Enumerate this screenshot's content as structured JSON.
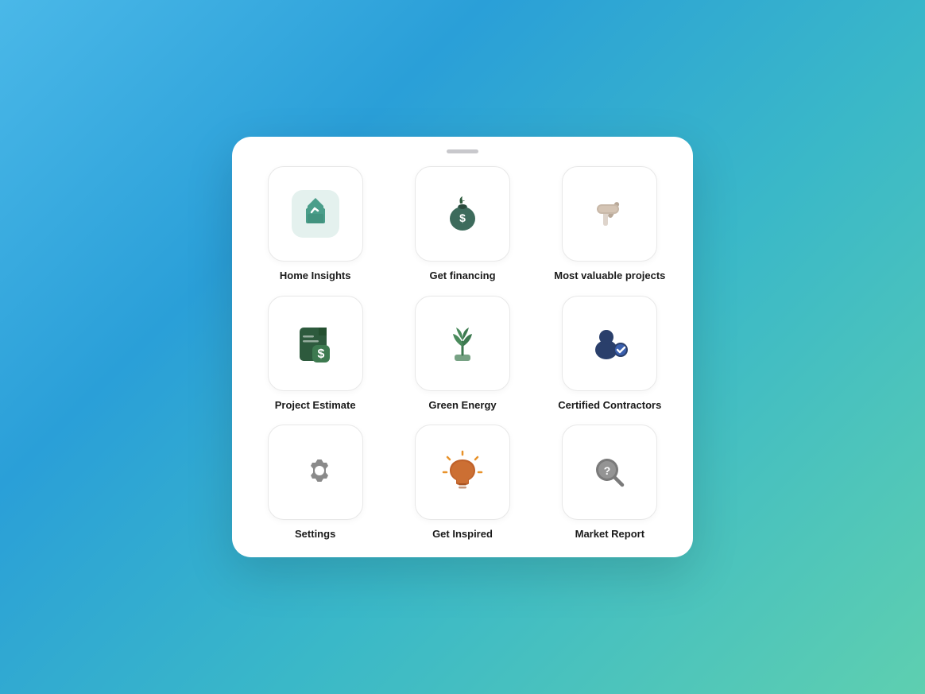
{
  "panel": {
    "drag_handle_color": "#c8c8cc"
  },
  "items": [
    {
      "id": "home-insights",
      "label": "Home Insights",
      "icon": "home-insights"
    },
    {
      "id": "get-financing",
      "label": "Get financing",
      "icon": "financing"
    },
    {
      "id": "most-valuable-projects",
      "label": "Most valuable projects",
      "icon": "projects"
    },
    {
      "id": "project-estimate",
      "label": "Project Estimate",
      "icon": "estimate"
    },
    {
      "id": "green-energy",
      "label": "Green Energy",
      "icon": "green-energy"
    },
    {
      "id": "certified-contractors",
      "label": "Certified Contractors",
      "icon": "contractors"
    },
    {
      "id": "settings",
      "label": "Settings",
      "icon": "settings"
    },
    {
      "id": "get-inspired",
      "label": "Get Inspired",
      "icon": "bulb"
    },
    {
      "id": "market-report",
      "label": "Market Report",
      "icon": "market"
    }
  ]
}
